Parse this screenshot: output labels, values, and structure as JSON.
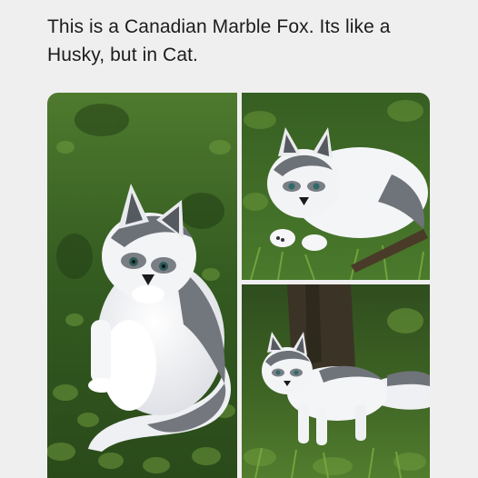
{
  "post": {
    "caption": "This is a Canadian Marble Fox. Its like a Husky, but in Cat."
  },
  "photos": [
    {
      "subject": "marble-fox-sitting-looking-back"
    },
    {
      "subject": "marble-fox-lying-in-grass"
    },
    {
      "subject": "marble-fox-standing-by-tree"
    }
  ],
  "colors": {
    "background": "#f0efef",
    "text": "#1c1c1c",
    "grass_dark": "#24401a",
    "grass_light": "#5f8a35",
    "fur_white": "#f4f4f6",
    "fur_gray": "#6f7278"
  }
}
